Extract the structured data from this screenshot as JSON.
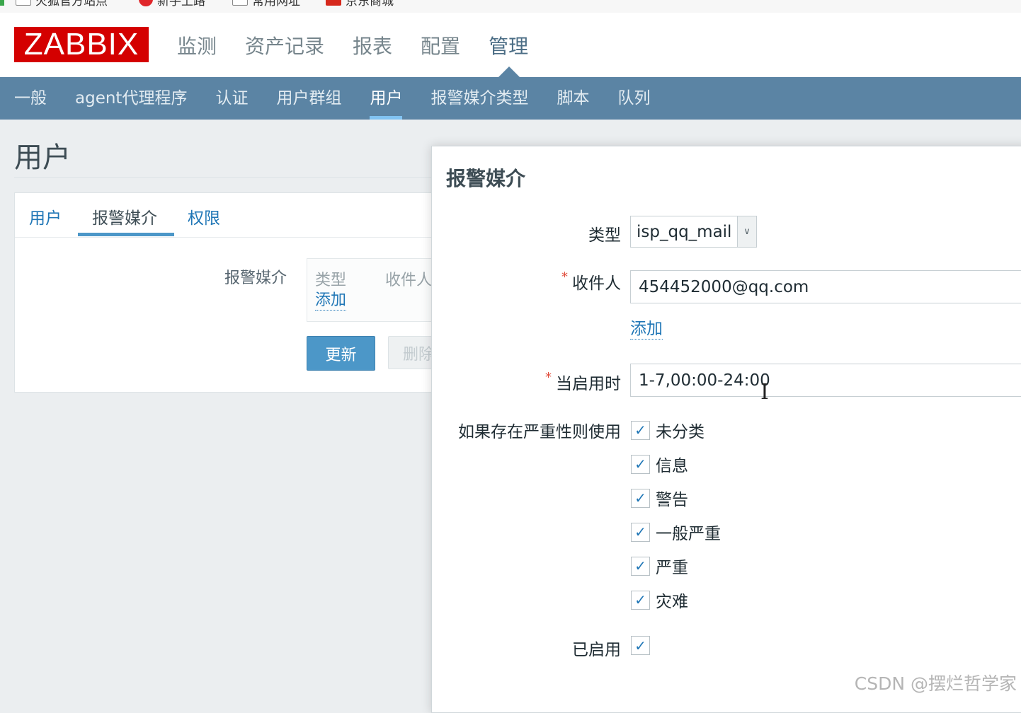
{
  "bookmarks": [
    {
      "label": "火狐官方站点",
      "icon": "folder-icon"
    },
    {
      "label": "新手上路",
      "icon": "firefox-icon"
    },
    {
      "label": "常用网址",
      "icon": "folder-icon"
    },
    {
      "label": "京东商城",
      "icon": "jd-icon"
    }
  ],
  "header": {
    "logo": "ZABBIX",
    "nav": [
      "监测",
      "资产记录",
      "报表",
      "配置",
      "管理"
    ],
    "active_nav": "管理"
  },
  "subnav": {
    "items": [
      "一般",
      "agent代理程序",
      "认证",
      "用户群组",
      "用户",
      "报警媒介类型",
      "脚本",
      "队列"
    ],
    "active": "用户"
  },
  "page": {
    "title": "用户",
    "tabs": [
      "用户",
      "报警媒介",
      "权限"
    ],
    "active_tab": "报警媒介",
    "media_label": "报警媒介",
    "media_table_headers": [
      "类型",
      "收件人"
    ],
    "media_add": "添加",
    "update_button": "更新",
    "delete_button": "删除"
  },
  "dialog": {
    "title": "报警媒介",
    "type_label": "类型",
    "type_value": "isp_qq_mail",
    "sendto_label": "收件人",
    "sendto_value": "454452000@qq.com",
    "add_link": "添加",
    "period_label": "当启用时",
    "period_value": "1-7,00:00-24:00",
    "severity_label": "如果存在严重性则使用",
    "severities": [
      {
        "label": "未分类",
        "checked": true
      },
      {
        "label": "信息",
        "checked": true
      },
      {
        "label": "警告",
        "checked": true
      },
      {
        "label": "一般严重",
        "checked": true
      },
      {
        "label": "严重",
        "checked": true
      },
      {
        "label": "灾难",
        "checked": true
      }
    ],
    "enabled_label": "已启用",
    "enabled": true,
    "required_mark": "*"
  },
  "watermark": "CSDN @摆烂哲学家",
  "colors": {
    "brand": "#d40000",
    "subnav_bg": "#5b84a4",
    "link": "#1f76b6",
    "button": "#4c97c8"
  }
}
